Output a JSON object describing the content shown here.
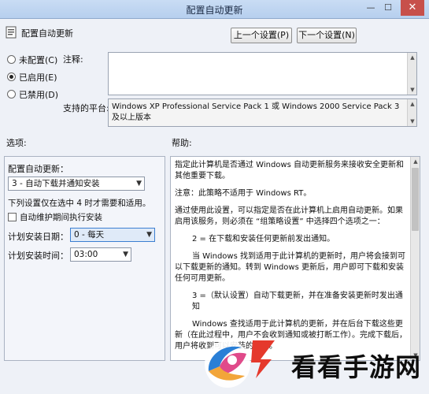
{
  "window": {
    "title": "配置自动更新",
    "minimize": "—",
    "maximize": "☐",
    "close": "✕"
  },
  "header": {
    "policy_name": "配置自动更新",
    "prev_button": "上一个设置(P)",
    "next_button": "下一个设置(N)"
  },
  "state": {
    "not_configured": "未配置(C)",
    "enabled": "已启用(E)",
    "disabled": "已禁用(D)",
    "selected": "enabled"
  },
  "comment": {
    "label": "注释:",
    "value": ""
  },
  "platform": {
    "label": "支持的平台:",
    "value": "Windows XP Professional Service Pack 1 或 Windows 2000 Service Pack 3 及以上版本"
  },
  "sections": {
    "options": "选项:",
    "help": "帮助:"
  },
  "options": {
    "configure_label": "配置自动更新：",
    "configure_value": "3 - 自动下载并通知安装",
    "note": "下列设置仅在选中 4 时才需要和适用。",
    "maintenance_checkbox": "自动维护期间执行安装",
    "maintenance_checked": false,
    "day_label": "计划安装日期：",
    "day_value": "0 - 每天",
    "time_label": "计划安装时间：",
    "time_value": "03:00"
  },
  "help": {
    "paragraphs": [
      "指定此计算机是否通过 Windows 自动更新服务来接收安全更新和其他重要下载。",
      "注意：此策略不适用于 Windows RT。",
      "通过使用此设置，可以指定是否在此计算机上启用自动更新。如果启用该服务，则必须在 “组策略设置” 中选择四个选项之一：",
      "2 = 在下载和安装任何更新前发出通知。",
      "当 Windows 找到适用于此计算机的更新时，用户将会接到可以下载更新的通知。转到 Windows 更新后，用户即可下载和安装任何可用更新。",
      "3 =（默认设置）自动下载更新，并在准备安装更新时发出通知",
      "Windows 查找适用于此计算机的更新，并在后台下载这些更新（在此过程中，用户不会收到通知或被打断工作）。完成下载后，用户将收到可以安装的通知。"
    ]
  },
  "watermark": {
    "text": "看看手游网"
  }
}
